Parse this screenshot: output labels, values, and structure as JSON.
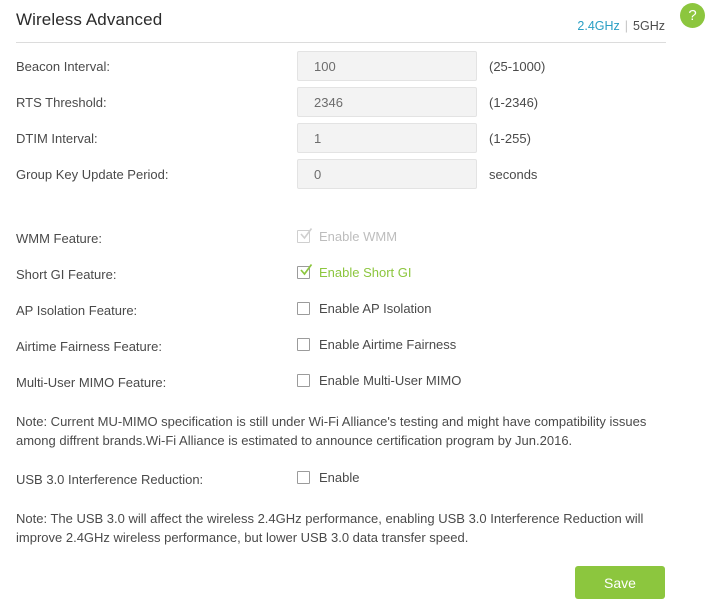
{
  "header": {
    "title": "Wireless Advanced",
    "bands": [
      {
        "label": "2.4GHz",
        "active": true
      },
      {
        "label": "5GHz",
        "active": false
      }
    ],
    "band_separator": "|",
    "help_glyph": "?",
    "help_name": "help-icon"
  },
  "fields": [
    {
      "label": "Beacon Interval:",
      "value": "100",
      "hint": "(25-1000)",
      "name": "beacon-interval"
    },
    {
      "label": "RTS Threshold:",
      "value": "2346",
      "hint": "(1-2346)",
      "name": "rts-threshold"
    },
    {
      "label": "DTIM Interval:",
      "value": "1",
      "hint": "(1-255)",
      "name": "dtim-interval"
    },
    {
      "label": "Group Key Update Period:",
      "value": "0",
      "hint": "seconds",
      "name": "group-key-update-period"
    }
  ],
  "checkboxes": [
    {
      "label": "WMM Feature:",
      "text": "Enable WMM",
      "checked": true,
      "disabled": true,
      "name": "wmm-feature"
    },
    {
      "label": "Short GI Feature:",
      "text": "Enable Short GI",
      "checked": true,
      "disabled": false,
      "name": "short-gi-feature"
    },
    {
      "label": "AP Isolation Feature:",
      "text": "Enable AP Isolation",
      "checked": false,
      "disabled": false,
      "name": "ap-isolation-feature"
    },
    {
      "label": "Airtime Fairness Feature:",
      "text": "Enable Airtime Fairness",
      "checked": false,
      "disabled": false,
      "name": "airtime-fairness-feature"
    },
    {
      "label": "Multi-User MIMO Feature:",
      "text": "Enable Multi-User MIMO",
      "checked": false,
      "disabled": false,
      "name": "multi-user-mimo-feature"
    }
  ],
  "notes": {
    "mimo": "Note: Current MU-MIMO specification is still under Wi-Fi Alliance's testing and might have compatibility issues among diffrent brands.Wi-Fi Alliance is estimated to announce certification program by Jun.2016.",
    "usb": "Note: The USB 3.0 will affect the wireless 2.4GHz performance, enabling USB 3.0 Interference Reduction will improve 2.4GHz wireless performance, but lower USB 3.0 data transfer speed."
  },
  "usb_row": {
    "label": "USB 3.0 Interference Reduction:",
    "text": "Enable",
    "checked": false,
    "name": "usb3-interference-reduction"
  },
  "footer": {
    "save_label": "Save"
  },
  "colors": {
    "accent_green": "#8cc63e",
    "active_band": "#2a9fc4",
    "text": "#4a4a4a",
    "input_bg": "#f3f3f3",
    "disabled_text": "#bdbdbd"
  }
}
